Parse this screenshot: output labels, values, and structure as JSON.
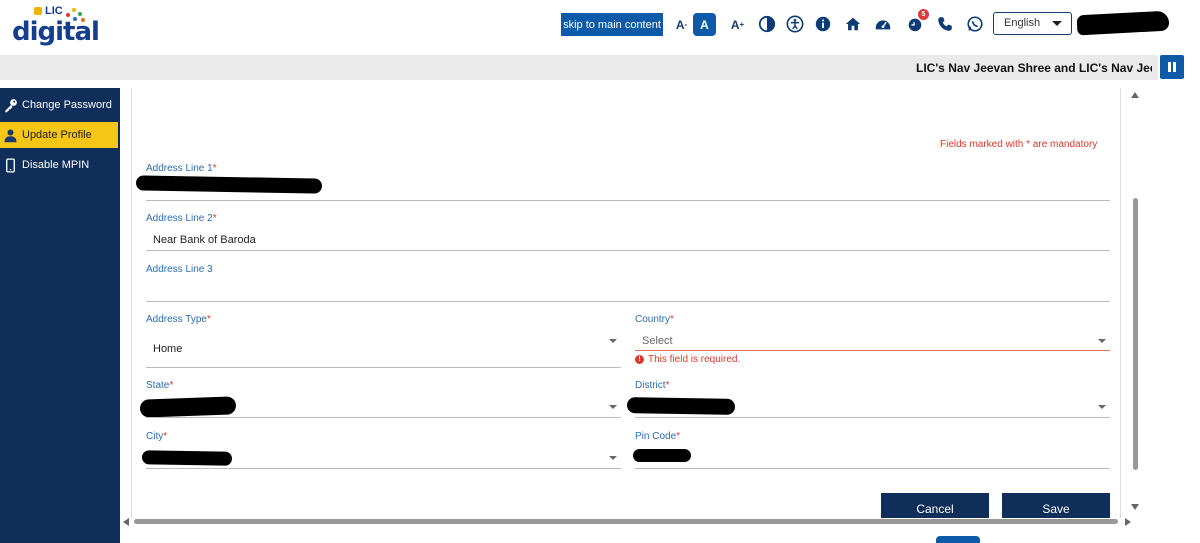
{
  "header": {
    "logo_top": "LIC",
    "logo_main": "digital",
    "skip_label": "skip to main content",
    "font_decrease": "A",
    "font_normal": "A",
    "font_increase": "A",
    "notification_count": "5",
    "language": "English"
  },
  "ticker": {
    "text": "LIC's Nav Jeevan Shree and LIC's Nav Jeevan S"
  },
  "sidebar": {
    "items": [
      {
        "label": "Change Password",
        "icon": "key-icon"
      },
      {
        "label": "Update Profile",
        "icon": "user-icon",
        "active": true
      },
      {
        "label": "Disable MPIN",
        "icon": "mobile-icon"
      }
    ]
  },
  "form": {
    "mandatory_note": "Fields marked with * are mandatory",
    "address1": {
      "label": "Address Line 1",
      "req": "*",
      "value": ""
    },
    "address2": {
      "label": "Address Line 2",
      "req": "*",
      "value": "Near Bank of Baroda"
    },
    "address3": {
      "label": "Address Line 3",
      "value": ""
    },
    "address_type": {
      "label": "Address Type",
      "req": "*",
      "value": "Home"
    },
    "country": {
      "label": "Country",
      "req": "*",
      "placeholder": "Select",
      "error": "This field is required."
    },
    "state": {
      "label": "State",
      "req": "*"
    },
    "district": {
      "label": "District",
      "req": "*"
    },
    "city": {
      "label": "City",
      "req": "*"
    },
    "pin_code": {
      "label": "Pin Code",
      "req": "*"
    },
    "cancel_label": "Cancel",
    "save_label": "Save"
  },
  "colors": {
    "primary": "#0d5ba8",
    "sidebar": "#0f2f5a",
    "active": "#f5c518",
    "label": "#2a6db5",
    "error": "#d93a2b"
  }
}
